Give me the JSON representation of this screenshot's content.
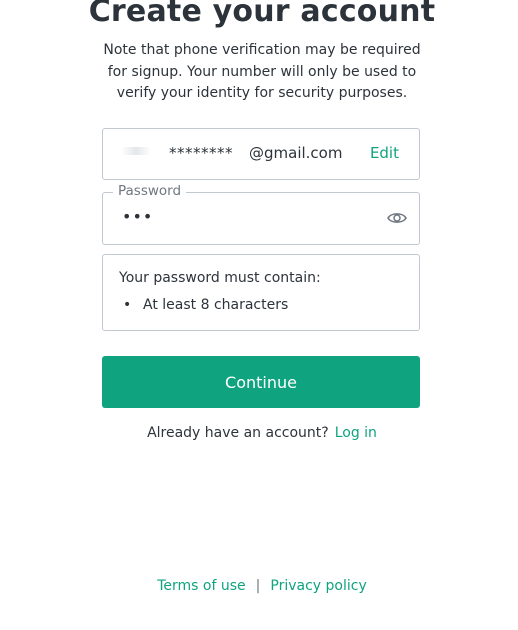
{
  "page": {
    "title": "Create your account",
    "subtitle": "Note that phone verification may be required for signup. Your number will only be used to verify your identity for security purposes."
  },
  "email_field": {
    "masked_value": "********",
    "domain": "@gmail.com",
    "edit_label": "Edit"
  },
  "password_field": {
    "label": "Password",
    "value": "•••",
    "toggle_icon": "eye-icon"
  },
  "requirements": {
    "title": "Your password must contain:",
    "bullet": "•",
    "items": [
      "At least 8 characters"
    ]
  },
  "continue_label": "Continue",
  "login": {
    "prompt": "Already have an account?",
    "link_label": "Log in"
  },
  "footer": {
    "terms_label": "Terms of use",
    "separator": "|",
    "privacy_label": "Privacy policy"
  },
  "colors": {
    "accent": "#10a37f",
    "text": "#2d333a",
    "border": "#c2c8d0",
    "muted": "#6f7780"
  }
}
